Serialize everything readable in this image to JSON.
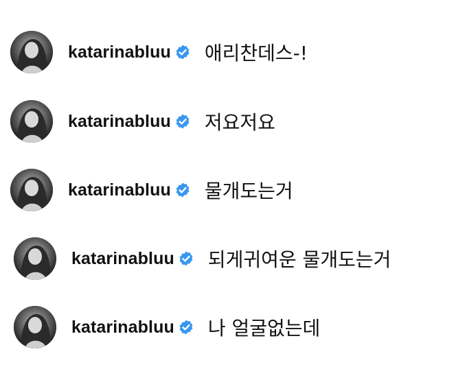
{
  "colors": {
    "verified_badge": "#3897f0",
    "text": "#111111",
    "background": "#ffffff"
  },
  "comments": [
    {
      "username": "katarinabluu",
      "verified_icon": "verified-badge-icon",
      "text": "애리찬데스-!"
    },
    {
      "username": "katarinabluu",
      "verified_icon": "verified-badge-icon",
      "text": "저요저요"
    },
    {
      "username": "katarinabluu",
      "verified_icon": "verified-badge-icon",
      "text": "물개도는거"
    },
    {
      "username": "katarinabluu",
      "verified_icon": "verified-badge-icon",
      "text": "되게귀여운 물개도는거"
    },
    {
      "username": "katarinabluu",
      "verified_icon": "verified-badge-icon",
      "text": "나 얼굴없는데"
    }
  ]
}
